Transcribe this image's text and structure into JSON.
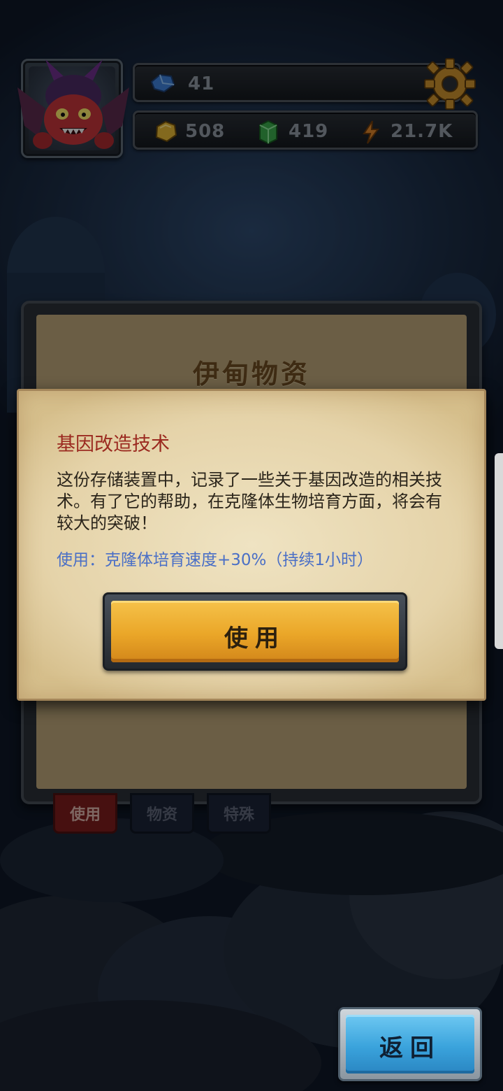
{
  "hud": {
    "gems": "41",
    "gold": "508",
    "crystal": "419",
    "energy": "21.7K"
  },
  "panel": {
    "title": "伊甸物资",
    "tabs": [
      "使用",
      "物资",
      "特殊"
    ]
  },
  "popup": {
    "title": "基因改造技术",
    "description": "这份存储装置中，记录了一些关于基因改造的相关技术。有了它的帮助，在克隆体生物培育方面，将会有较大的突破！",
    "effect": "使用：克隆体培育速度+30%（持续1小时）",
    "use_button": "使用"
  },
  "back_button": "返回",
  "colors": {
    "popup_title": "#9b2a20",
    "effect_text": "#4a6fc6",
    "use_button": "#eaa628",
    "back_button": "#3aa3dc"
  },
  "icons": [
    "avatar-demon-icon",
    "gem-icon",
    "gold-icon",
    "crystal-icon",
    "energy-icon",
    "gear-icon"
  ]
}
